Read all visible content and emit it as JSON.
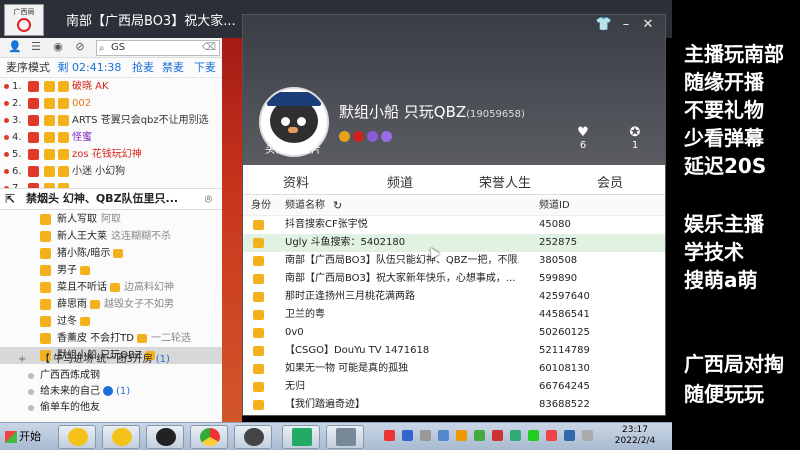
{
  "window": {
    "title": "南部【广西局BO3】祝大家...",
    "logo_text": "广西局"
  },
  "left_panel": {
    "search_value": "GS",
    "mic_mode_label": "麦序模式",
    "timer_label": "剩",
    "timer": "02:41:38",
    "links": [
      "抢麦",
      "禁麦",
      "下麦"
    ],
    "queue": [
      {
        "num": "1.",
        "name": "破晓 AK",
        "color": "#d8261b"
      },
      {
        "num": "2.",
        "name": "002",
        "color": "#e07a10"
      },
      {
        "num": "3.",
        "name": "ARTS 苍翼只会qbz不让用别选",
        "color": "#333333"
      },
      {
        "num": "4.",
        "name": "怪蜜",
        "color": "#7a2ab8"
      },
      {
        "num": "5.",
        "name": "zos 花钱玩幻神",
        "color": "#d8261b"
      },
      {
        "num": "6.",
        "name": "小迷 小幻狗",
        "color": "#333333"
      },
      {
        "num": "7.",
        "name": "",
        "color": "#333333"
      }
    ],
    "channel_header": "禁烟头 幻神、QBZ队伍里只...",
    "members": [
      {
        "name": "新人写取",
        "tag": "阿取",
        "mini": false
      },
      {
        "name": "新人王大莱",
        "tag": "这连糊糊不杀",
        "mini": false
      },
      {
        "name": "猪小陈/暗示",
        "tag": "",
        "mini": true
      },
      {
        "name": "男子",
        "tag": "",
        "mini": true
      },
      {
        "name": "菜且不听话",
        "tag": "边高料幻神",
        "mini": true
      },
      {
        "name": "薛思雨",
        "tag": "越毁女子不如男",
        "mini": true
      },
      {
        "name": "过冬",
        "tag": "",
        "mini": true
      },
      {
        "name": "香薰皮 不会打TD",
        "tag": "一二轮选",
        "mini": true
      },
      {
        "name": "默组小船 只玩QBZ",
        "tag": "",
        "mini": true,
        "selected": true
      }
    ],
    "subchannels": [
      {
        "expander": "+",
        "name": "【 牛马进场 统一团3开房",
        "count": "(1)",
        "blue_icon": false
      },
      {
        "expander": "",
        "name": "广西西炼成钢",
        "count": "",
        "blue_icon": false
      },
      {
        "expander": "",
        "name": "给未来的自己",
        "count": "(1)",
        "blue_icon": true
      },
      {
        "expander": "",
        "name": "偷单车的他友",
        "count": "",
        "blue_icon": false
      }
    ]
  },
  "profile": {
    "nickname": "默组小船 只玩QBZ",
    "uid": "(19059658)",
    "avatar_tabs": [
      "头像",
      "名片"
    ],
    "stats": [
      {
        "icon": "heart-icon",
        "value": "6"
      },
      {
        "icon": "medal-icon",
        "value": "1"
      }
    ],
    "tabs": [
      "资料",
      "频道",
      "荣誉人生",
      "会员"
    ],
    "active_tab": "频道",
    "columns": [
      "身份",
      "频道名称",
      "频道ID"
    ],
    "channels": [
      {
        "name": "抖音搜索CF张宇悦",
        "id": "45080"
      },
      {
        "name": "Ugly 斗鱼搜索：5402180",
        "id": "252875",
        "highlighted": true
      },
      {
        "name": "南部【广西局BO3】队伍只能幻神、QBZ一把，不限...",
        "id": "380508"
      },
      {
        "name": "南部【广西局BO3】祝大家新年快乐，心想事成，...",
        "id": "599890"
      },
      {
        "name": "那时正逢扬州三月桃花满两路",
        "id": "42597640"
      },
      {
        "name": "卫兰的粤",
        "id": "44586541"
      },
      {
        "name": "0v0",
        "id": "50260125"
      },
      {
        "name": "【CSGO】DouYu TV  1471618",
        "id": "52114789"
      },
      {
        "name": "如果无一物 可能是真的孤独",
        "id": "60108130"
      },
      {
        "name": "无归",
        "id": "66764245"
      },
      {
        "name": "【我们踏遍奇迹】",
        "id": "83688522"
      }
    ]
  },
  "overlay_text": [
    "主播玩南部",
    "随缘开播",
    "不要礼物",
    "少看弹幕",
    "延迟20S",
    "娱乐主播",
    "学技术",
    "搜萌a萌",
    "广西局对掏",
    "随便玩玩"
  ],
  "taskbar": {
    "start_label": "开始",
    "time": "23:17",
    "date": "2022/2/4"
  }
}
